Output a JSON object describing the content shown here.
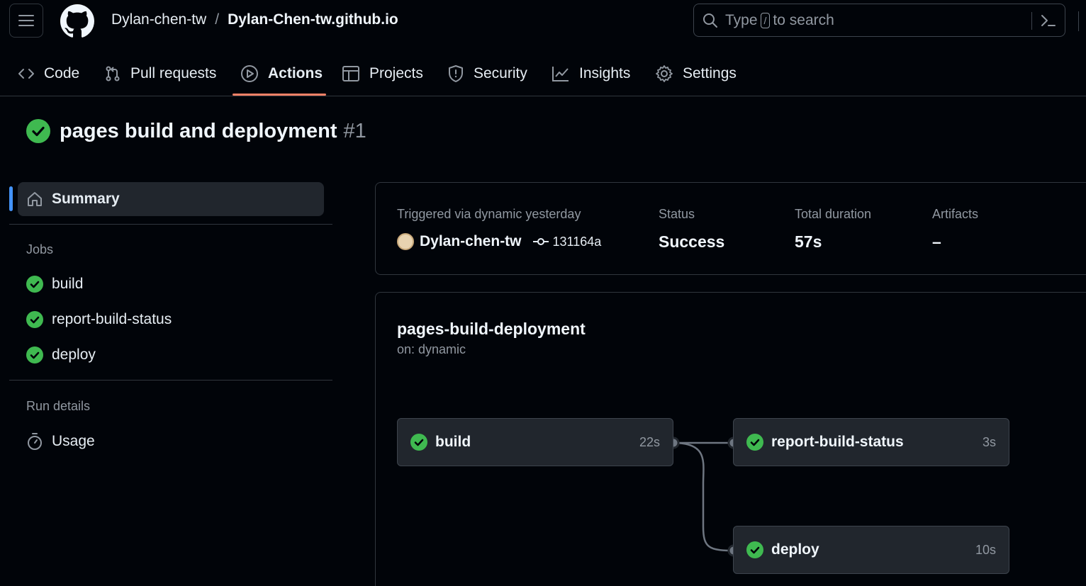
{
  "header": {
    "owner": "Dylan-chen-tw",
    "separator": "/",
    "repo": "Dylan-Chen-tw.github.io",
    "search_prefix": "Type",
    "search_key": "/",
    "search_suffix": "to search"
  },
  "tabs": [
    {
      "label": "Code",
      "icon": "code-icon"
    },
    {
      "label": "Pull requests",
      "icon": "git-pull-request-icon"
    },
    {
      "label": "Actions",
      "icon": "play-icon",
      "active": true
    },
    {
      "label": "Projects",
      "icon": "table-icon"
    },
    {
      "label": "Security",
      "icon": "shield-icon"
    },
    {
      "label": "Insights",
      "icon": "graph-icon"
    },
    {
      "label": "Settings",
      "icon": "gear-icon"
    }
  ],
  "run": {
    "title": "pages build and deployment",
    "number": "#1"
  },
  "sidebar": {
    "summary_label": "Summary",
    "jobs_heading": "Jobs",
    "jobs": [
      "build",
      "report-build-status",
      "deploy"
    ],
    "run_details_heading": "Run details",
    "usage_label": "Usage"
  },
  "summary": {
    "trigger_label": "Triggered via dynamic yesterday",
    "actor": "Dylan-chen-tw",
    "commit": "131164a",
    "status_label": "Status",
    "status_value": "Success",
    "duration_label": "Total duration",
    "duration_value": "57s",
    "artifacts_label": "Artifacts",
    "artifacts_value": "–"
  },
  "workflow": {
    "name": "pages-build-deployment",
    "trigger": "on: dynamic",
    "jobs": [
      {
        "name": "build",
        "duration": "22s"
      },
      {
        "name": "report-build-status",
        "duration": "3s"
      },
      {
        "name": "deploy",
        "duration": "10s"
      }
    ]
  },
  "colors": {
    "success": "#3fb950",
    "accent": "#4493f8",
    "tab_underline": "#f78166"
  }
}
